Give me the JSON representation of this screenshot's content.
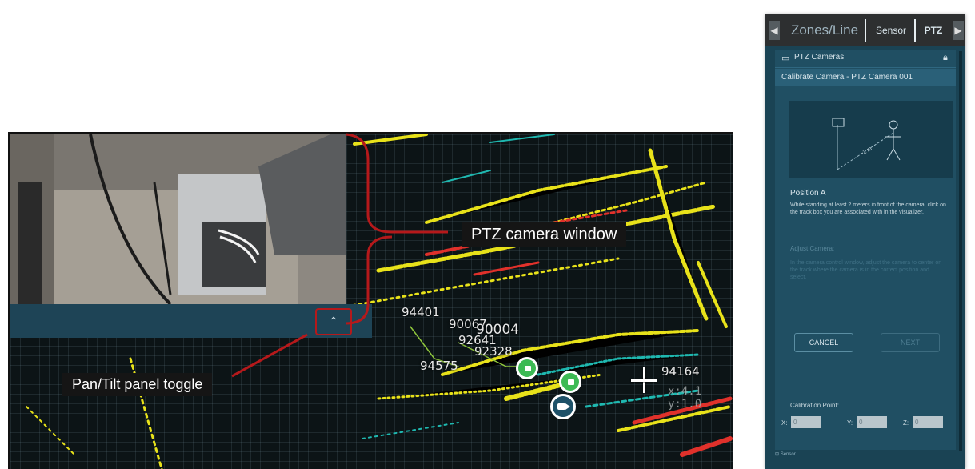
{
  "callouts": {
    "ptz_window": "PTZ camera window",
    "pan_tilt_toggle": "Pan/Tilt panel toggle"
  },
  "visualizer": {
    "track_ids": [
      "94401",
      "90067",
      "90004",
      "92641",
      "92328",
      "94575",
      "94164"
    ],
    "coord_readout": "x:4.1 y:1.0",
    "toggle_glyph": "⌃"
  },
  "panel": {
    "tabs": [
      "Zones/Line",
      "Sensor",
      "PTZ"
    ],
    "section_title": "PTZ Cameras",
    "subsection_title": "Calibrate Camera - PTZ Camera 001",
    "diagram_label": "~2 m",
    "position_title": "Position A",
    "position_desc": "While standing at least 2 meters in front of the camera, click on the track box you are associated with in the visualizer.",
    "adjust_title": "Adjust Camera:",
    "adjust_desc": "In the camera control window, adjust the camera to center on the track where the camera is in the correct position and select.",
    "cancel_label": "CANCEL",
    "next_label": "NEXT",
    "calibration_label": "Calibration Point:",
    "x_label": "X:",
    "y_label": "Y:",
    "z_label": "Z:",
    "x_value": "0",
    "y_value": "0",
    "z_value": "0",
    "footer": "Sensor"
  },
  "colors": {
    "callout_line": "#b5191b",
    "panel_bg": "#1a4354",
    "point_yellow": "#e8e21a",
    "point_cyan": "#1fb8b0",
    "point_red": "#e0312b",
    "track_green": "#3cba54"
  }
}
